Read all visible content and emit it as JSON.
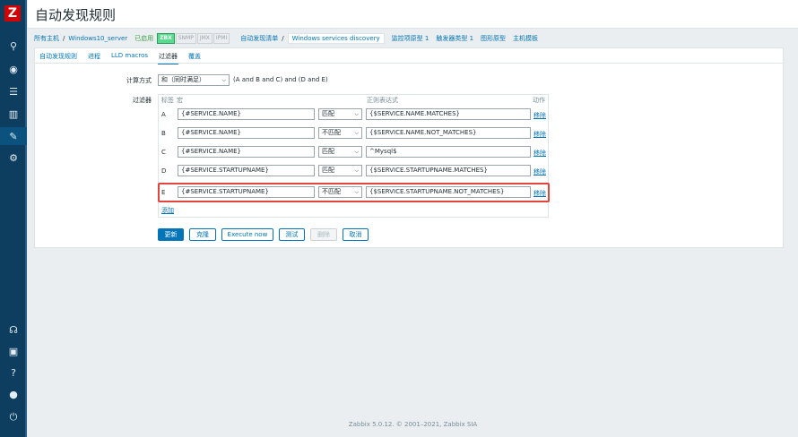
{
  "app": {
    "logo": "Z",
    "title": "自动发现规则"
  },
  "sidebar": {
    "icons": [
      "search-icon",
      "monitoring-eye-icon",
      "inventory-list-icon",
      "reports-chart-icon",
      "configuration-wrench-icon",
      "administration-gear-icon",
      "support-icon",
      "share-icon",
      "help-icon",
      "user-icon",
      "logout-icon"
    ]
  },
  "breadcrumb": {
    "all_hosts": "所有主机",
    "host": "Windows10_server",
    "status": "已启用",
    "tags": [
      "ZBX",
      "SNMP",
      "JMX",
      "IPMI"
    ],
    "discovery_list": "自动发现清单",
    "current": "Windows services discovery",
    "item_prototypes": "监控项原型 1",
    "trigger_prototypes": "触发器类型 1",
    "graph_prototypes": "图形原型",
    "host_prototypes": "主机模板"
  },
  "tabs": [
    "自动发现规则",
    "进程",
    "LLD macros",
    "过滤器",
    "覆盖"
  ],
  "active_tab": "过滤器",
  "form": {
    "calc_label": "计算方式",
    "calc_value": "和（同时满足）",
    "calc_expression": "(A and B and C) and (D and E)",
    "filters_label": "过滤器",
    "col_label": "标签",
    "col_macro": "宏",
    "col_regex": "正则表达式",
    "col_action": "动作",
    "rows": [
      {
        "label": "A",
        "macro": "{#SERVICE.NAME}",
        "op": "匹配",
        "regex": "{$SERVICE.NAME.MATCHES}",
        "action": "移除"
      },
      {
        "label": "B",
        "macro": "{#SERVICE.NAME}",
        "op": "不匹配",
        "regex": "{$SERVICE.NAME.NOT_MATCHES}",
        "action": "移除"
      },
      {
        "label": "C",
        "macro": "{#SERVICE.NAME}",
        "op": "匹配",
        "regex": "^Mysql$",
        "action": "移除"
      },
      {
        "label": "D",
        "macro": "{#SERVICE.STARTUPNAME}",
        "op": "匹配",
        "regex": "{$SERVICE.STARTUPNAME.MATCHES}",
        "action": "移除"
      },
      {
        "label": "E",
        "macro": "{#SERVICE.STARTUPNAME}",
        "op": "不匹配",
        "regex": "{$SERVICE.STARTUPNAME.NOT_MATCHES}",
        "action": "移除"
      }
    ],
    "add": "添加"
  },
  "buttons": {
    "update": "更新",
    "clone": "克隆",
    "execute": "Execute now",
    "test": "测试",
    "delete": "删除",
    "cancel": "取消"
  },
  "footer": {
    "text": "Zabbix 5.0.12. © 2001–2021,",
    "company": "Zabbix SIA"
  }
}
